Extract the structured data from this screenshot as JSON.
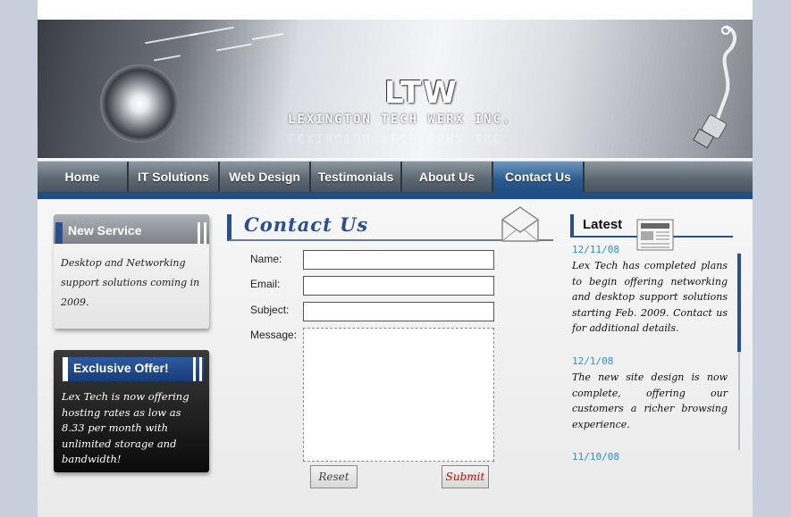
{
  "header": {
    "logo_mark": "LTW",
    "company_name": "LEXINGTON TECH WERX INC."
  },
  "nav": {
    "items": [
      {
        "label": "Home"
      },
      {
        "label": "IT Solutions"
      },
      {
        "label": "Web Design"
      },
      {
        "label": "Testimonials"
      },
      {
        "label": "About Us"
      },
      {
        "label": "Contact Us",
        "active": true
      }
    ]
  },
  "sidebar": {
    "new_service": {
      "title": "New Service",
      "text": "Desktop and Networking support solutions coming in 2009."
    },
    "exclusive_offer": {
      "title": "Exclusive Offer!",
      "text": "Lex Tech is now offering hosting rates as low as 8.33 per month with unlimited storage and bandwidth!"
    }
  },
  "contact": {
    "title": "Contact Us",
    "fields": {
      "name_label": "Name:",
      "email_label": "Email:",
      "subject_label": "Subject:",
      "message_label": "Message:",
      "name_value": "",
      "email_value": "",
      "subject_value": "",
      "message_value": ""
    },
    "reset_label": "Reset",
    "submit_label": "Submit"
  },
  "latest": {
    "title": "Latest",
    "items": [
      {
        "date": "12/11/08",
        "text": "Lex Tech has completed plans to begin offering networking and desktop support solutions starting Feb. 2009. Contact us for additional details."
      },
      {
        "date": "12/1/08",
        "text": "The new site design is now complete, offering our customers a richer browsing experience."
      },
      {
        "date": "11/10/08",
        "text": ""
      }
    ]
  },
  "colors": {
    "brand_blue": "#2b4f8c",
    "nav_gray": "#5c6872",
    "date_blue": "#2c8fcf",
    "submit_red": "#cc0000"
  },
  "icons": [
    "envelope-icon",
    "newspaper-icon",
    "usb-cable-icon",
    "lens-graphic"
  ]
}
